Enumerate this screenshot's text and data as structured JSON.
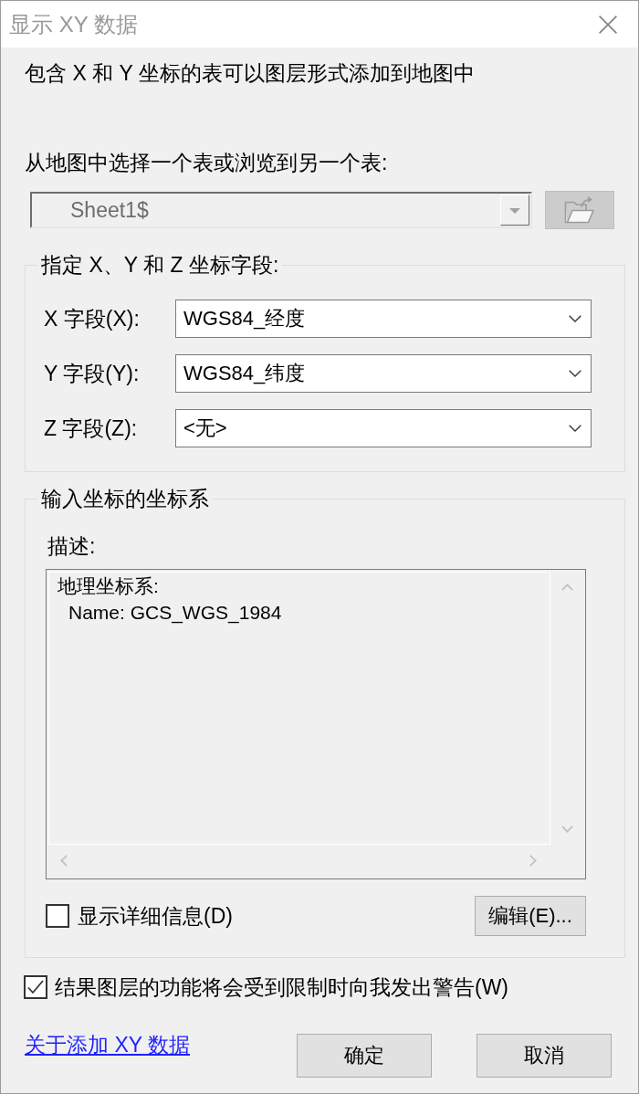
{
  "window": {
    "title": "显示 XY 数据"
  },
  "intro": "包含 X 和 Y 坐标的表可以图层形式添加到地图中",
  "table_source": {
    "label": "从地图中选择一个表或浏览到另一个表:",
    "value": "Sheet1$",
    "disabled": true,
    "browse_disabled": true
  },
  "coordinate_fields": {
    "title": "指定 X、Y 和 Z 坐标字段:",
    "fields": [
      {
        "label": "X 字段(X):",
        "value": "WGS84_经度"
      },
      {
        "label": "Y 字段(Y):",
        "value": "WGS84_纬度"
      },
      {
        "label": "Z 字段(Z):",
        "value": "<无>"
      }
    ]
  },
  "coordinate_system": {
    "title": "输入坐标的坐标系",
    "description_label": "描述:",
    "description": [
      {
        "text": "地理坐标系:",
        "children": [
          {
            "text": "Name: GCS_WGS_1984"
          }
        ]
      }
    ],
    "show_details": {
      "label": "显示详细信息(D)",
      "checked": false
    },
    "edit_button": "编辑(E)..."
  },
  "warning_option": {
    "label": "结果图层的功能将会受到限制时向我发出警告(W)",
    "checked": true
  },
  "help_link": "关于添加 XY 数据",
  "buttons": [
    "确定",
    "取消"
  ]
}
